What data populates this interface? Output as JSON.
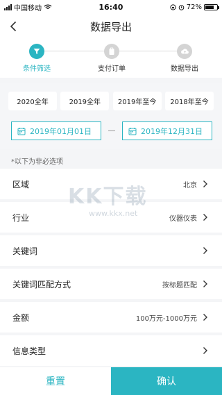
{
  "status_bar": {
    "carrier": "中国移动",
    "time": "16:40",
    "battery": "72%",
    "battery_level": 0.72
  },
  "nav": {
    "title": "数据导出"
  },
  "steps": [
    {
      "label": "条件筛选",
      "active": true,
      "icon": "filter-icon"
    },
    {
      "label": "支付订单",
      "active": false,
      "icon": "clipboard-icon"
    },
    {
      "label": "数据导出",
      "active": false,
      "icon": "cloud-upload-icon"
    }
  ],
  "year_filters": [
    "2020全年",
    "2019全年",
    "2019年至今",
    "2018年至今"
  ],
  "date_range": {
    "start": "2019年01月01日",
    "end": "2019年12月31日"
  },
  "optional_note": "*以下为非必选项",
  "options": [
    {
      "label": "区域",
      "value": "北京"
    },
    {
      "label": "行业",
      "value": "仪器仪表"
    },
    {
      "label": "关键词",
      "value": ""
    },
    {
      "label": "关键词匹配方式",
      "value": "按标题匹配"
    },
    {
      "label": "金额",
      "value": "100万元-1000万元"
    },
    {
      "label": "信息类型",
      "value": ""
    }
  ],
  "footer": {
    "reset_label": "重置",
    "confirm_label": "确认"
  },
  "watermark": {
    "brand": "KK下载",
    "url": "www.kkx.net"
  },
  "colors": {
    "accent": "#2bb5c2",
    "background": "#f4f5f7"
  }
}
